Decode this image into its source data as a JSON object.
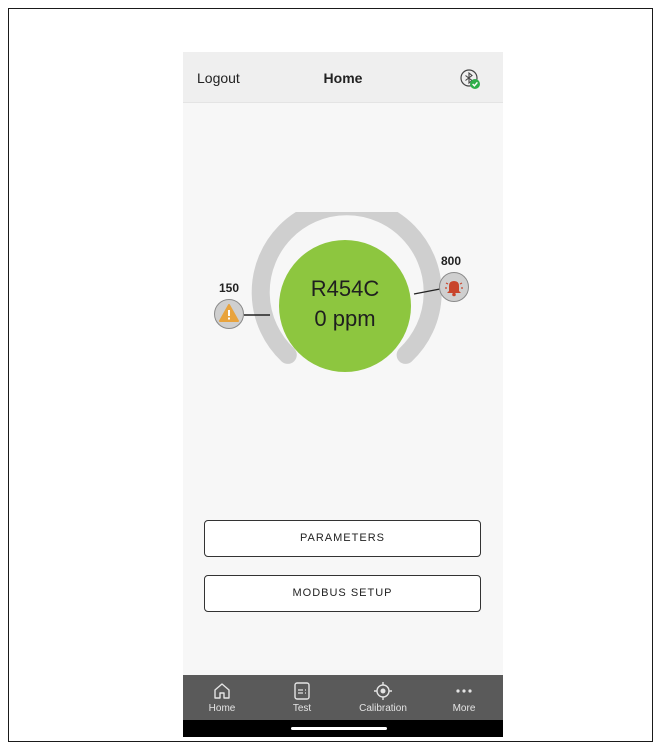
{
  "header": {
    "logout_label": "Logout",
    "title": "Home",
    "status_icon": "bluetooth-connected-icon"
  },
  "gauge": {
    "gas": "R454C",
    "reading": "0 ppm",
    "warning_threshold": "150",
    "alarm_threshold": "800",
    "warning_icon": "warning-icon",
    "alarm_icon": "alarm-bell-icon",
    "center_color": "#8dc63f",
    "track_color": "#cfcfcf"
  },
  "buttons": {
    "parameters": "PARAMETERS",
    "modbus_setup": "MODBUS SETUP"
  },
  "tabs": [
    {
      "label": "Home",
      "icon": "home-icon"
    },
    {
      "label": "Test",
      "icon": "test-icon"
    },
    {
      "label": "Calibration",
      "icon": "calibration-icon"
    },
    {
      "label": "More",
      "icon": "more-icon"
    }
  ],
  "colors": {
    "warning": "#e8a33d",
    "alarm": "#c8452c",
    "tabbar": "#5a5a5a"
  }
}
